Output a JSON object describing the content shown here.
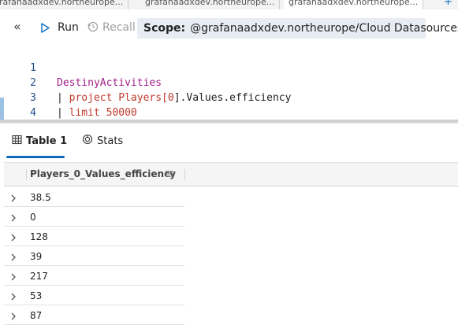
{
  "tabs": [
    {
      "label": "grafanaadxdev.northeurope..."
    },
    {
      "label": "grafanaadxdev.northeurope..."
    },
    {
      "label": "grafanaadxdev.northeurope..."
    }
  ],
  "tab_add_label": "+",
  "toolbar": {
    "collapse_label": "«",
    "run_label": "Run",
    "recall_label": "Recall",
    "scope_label": "Scope:",
    "scope_value": "@grafanaadxdev.northeurope/Cloud Datasources"
  },
  "editor": {
    "line_numbers": [
      "1",
      "2",
      "3",
      "4"
    ],
    "line1": {
      "table": "DestinyActivities"
    },
    "line2": {
      "pipe": "| ",
      "op": "project",
      "rest_a": " Players[",
      "idx": "0",
      "rest_b": "].Values.efficiency"
    },
    "line3": {
      "pipe": "| ",
      "op": "limit",
      "num": " 50000"
    }
  },
  "result_tabs": {
    "table_label": "Table 1",
    "stats_label": "Stats"
  },
  "grid": {
    "column_header": "Players_0_Values_efficiency",
    "rows": [
      "38.5",
      "0",
      "128",
      "39",
      "217",
      "53",
      "87"
    ]
  },
  "colors": {
    "accent": "#0f6cbd",
    "scope_bg": "#e8edf3",
    "keyword": "#a21f8c",
    "operator": "#c0392b"
  },
  "icons": [
    "chevron-double-left-icon",
    "play-icon",
    "recall-icon",
    "table-icon",
    "stats-icon",
    "column-menu-icon",
    "chevron-right-icon"
  ]
}
